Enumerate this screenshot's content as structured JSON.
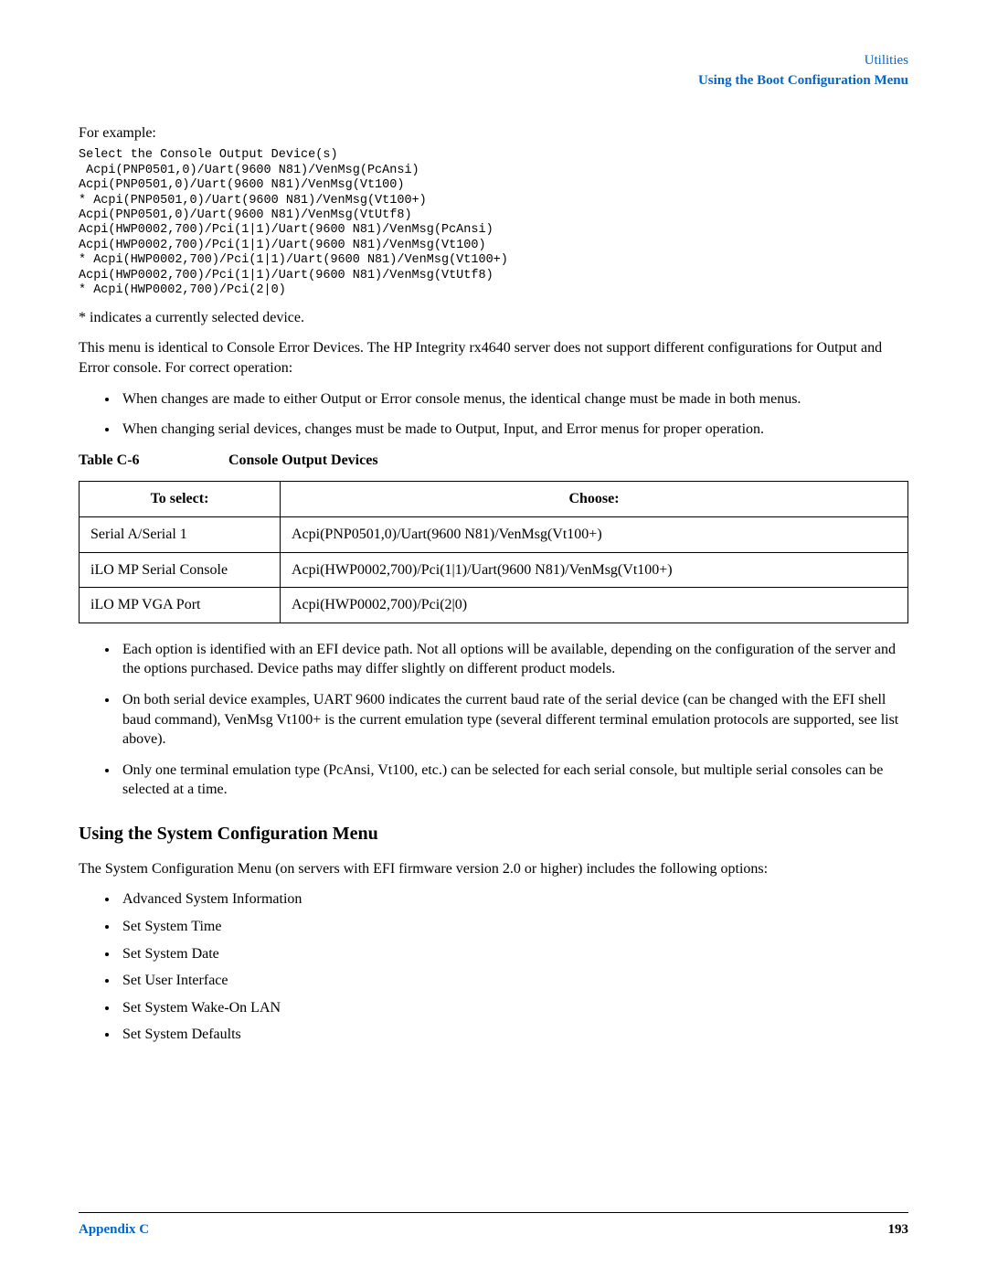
{
  "header": {
    "line1": "Utilities",
    "line2": "Using the Boot Configuration Menu"
  },
  "intro_lead": "For example:",
  "code_block": "Select the Console Output Device(s)\n Acpi(PNP0501,0)/Uart(9600 N81)/VenMsg(PcAnsi)\nAcpi(PNP0501,0)/Uart(9600 N81)/VenMsg(Vt100)\n* Acpi(PNP0501,0)/Uart(9600 N81)/VenMsg(Vt100+)\nAcpi(PNP0501,0)/Uart(9600 N81)/VenMsg(VtUtf8)\nAcpi(HWP0002,700)/Pci(1|1)/Uart(9600 N81)/VenMsg(PcAnsi)\nAcpi(HWP0002,700)/Pci(1|1)/Uart(9600 N81)/VenMsg(Vt100)\n* Acpi(HWP0002,700)/Pci(1|1)/Uart(9600 N81)/VenMsg(Vt100+)\nAcpi(HWP0002,700)/Pci(1|1)/Uart(9600 N81)/VenMsg(VtUtf8)\n* Acpi(HWP0002,700)/Pci(2|0)",
  "para_indicates": "* indicates a currently selected device.",
  "para_identical": "This menu is identical to Console Error Devices. The HP Integrity rx4640 server does not support different configurations for Output and Error console. For correct operation:",
  "bullets_a": [
    "When changes are made to either Output or Error console menus, the identical change must be made in both menus.",
    "When changing serial devices, changes must be made to Output, Input, and Error menus for proper operation."
  ],
  "table": {
    "caption_num": "Table C-6",
    "caption_title": "Console Output Devices",
    "head": [
      "To select:",
      "Choose:"
    ],
    "rows": [
      [
        "Serial A/Serial 1",
        "Acpi(PNP0501,0)/Uart(9600 N81)/VenMsg(Vt100+)"
      ],
      [
        "iLO MP Serial Console",
        "Acpi(HWP0002,700)/Pci(1|1)/Uart(9600 N81)/VenMsg(Vt100+)"
      ],
      [
        "iLO MP VGA Port",
        "Acpi(HWP0002,700)/Pci(2|0)"
      ]
    ]
  },
  "bullets_b": [
    "Each option is identified with an EFI device path. Not all options will be available, depending on the configuration of the server and the options purchased. Device paths may differ slightly on different product models.",
    "On both serial device examples, UART 9600 indicates the current baud rate of the serial device (can be changed with the EFI shell baud command), VenMsg Vt100+ is the current emulation type (several different terminal emulation protocols are supported, see list above).",
    "Only one terminal emulation type (PcAnsi, Vt100, etc.) can be selected for each serial console, but multiple serial consoles can be selected at a time."
  ],
  "section": {
    "heading": "Using the System Configuration Menu",
    "intro": "The System Configuration Menu (on servers with EFI firmware version 2.0 or higher) includes the following options:",
    "items": [
      "Advanced System Information",
      "Set System Time",
      "Set System Date",
      "Set User Interface",
      "Set System Wake-On LAN",
      "Set System Defaults"
    ]
  },
  "footer": {
    "left": "Appendix C",
    "right": "193"
  }
}
